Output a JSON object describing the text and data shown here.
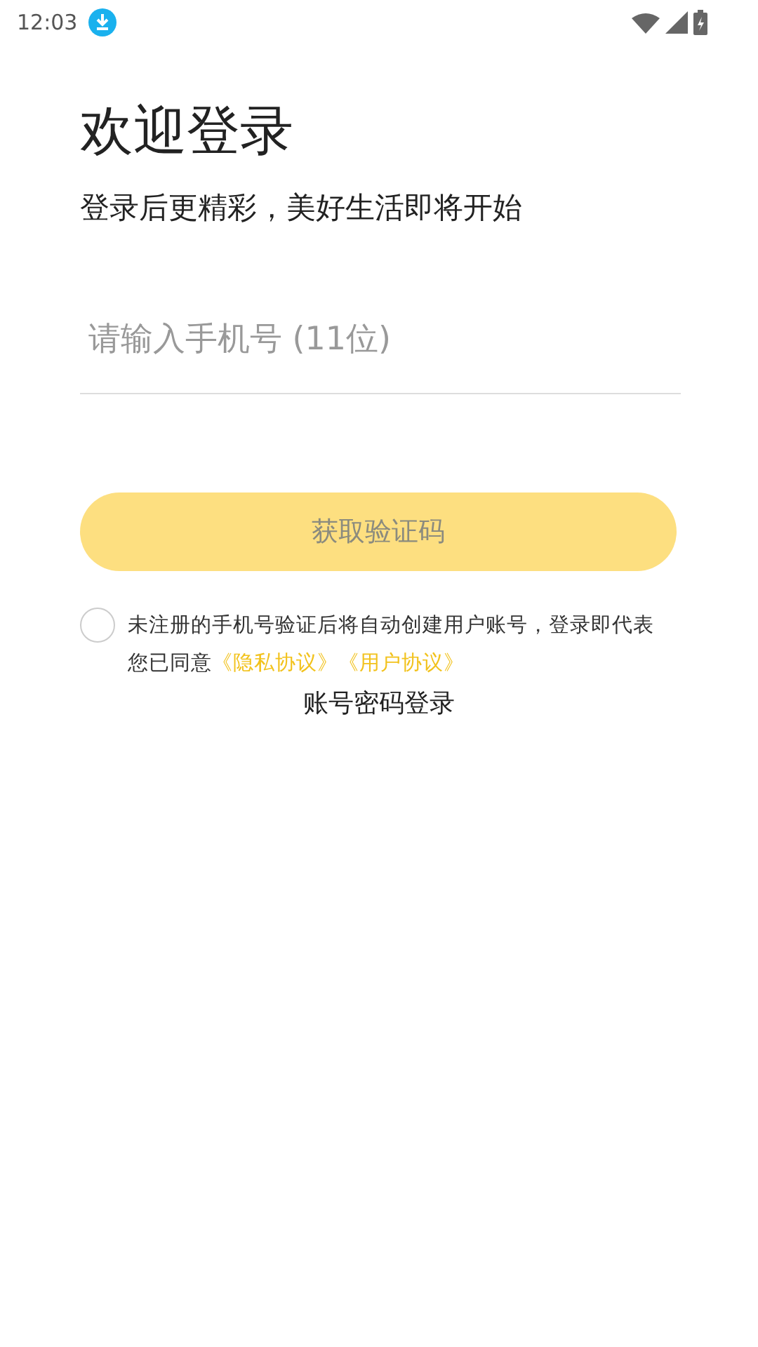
{
  "status_bar": {
    "time": "12:03"
  },
  "title": "欢迎登录",
  "subtitle": "登录后更精彩，美好生活即将开始",
  "phone_field": {
    "placeholder": "请输入手机号 (11位)"
  },
  "code_button": {
    "label": "获取验证码",
    "disabled": true
  },
  "agreement": {
    "checked": false,
    "text": "未注册的手机号验证后将自动创建用户账号，登录即代表您已同意",
    "links": [
      "《隐私协议》",
      "《用户协议》"
    ]
  },
  "password_login_link": "账号密码登录"
}
